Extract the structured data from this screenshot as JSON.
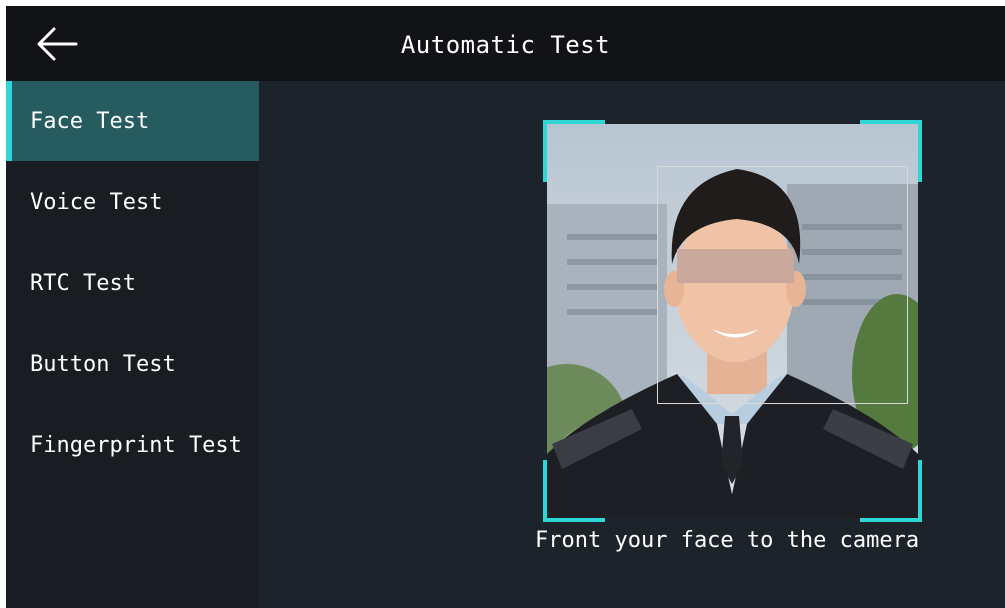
{
  "header": {
    "title": "Automatic Test",
    "back_icon": "arrow-left-icon"
  },
  "sidebar": {
    "items": [
      {
        "label": "Face Test",
        "active": true
      },
      {
        "label": "Voice Test",
        "active": false
      },
      {
        "label": "RTC Test",
        "active": false
      },
      {
        "label": "Button Test",
        "active": false
      },
      {
        "label": "Fingerprint Test",
        "active": false
      }
    ]
  },
  "main": {
    "hint": "Front your face to the camera"
  },
  "colors": {
    "accent": "#2ed6d6",
    "active_item_bg": "#265b5f",
    "title_bar_bg": "#121316",
    "content_bg": "#1d232b",
    "sidebar_bg": "#191c21"
  }
}
